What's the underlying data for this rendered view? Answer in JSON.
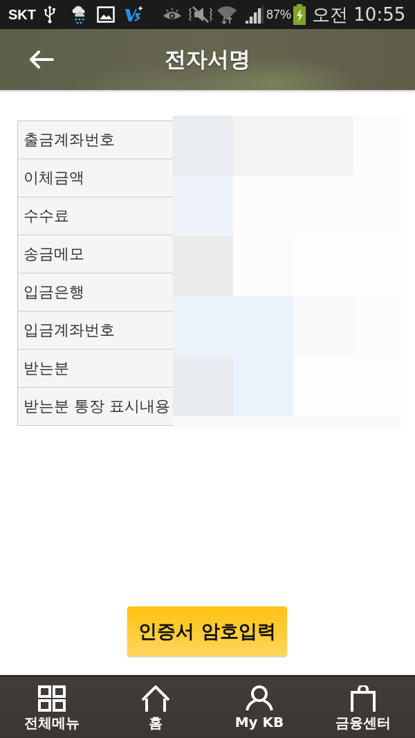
{
  "status_bar": {
    "carrier": "SKT",
    "battery": "87%",
    "time": "오전 10:55"
  },
  "header": {
    "title": "전자서명"
  },
  "details": {
    "rows": [
      {
        "label": "출금계좌번호"
      },
      {
        "label": "이체금액"
      },
      {
        "label": "수수료"
      },
      {
        "label": "송금메모"
      },
      {
        "label": "입금은행"
      },
      {
        "label": "입금계좌번호"
      },
      {
        "label": "받는분"
      },
      {
        "label": "받는분 통장 표시내용"
      }
    ]
  },
  "primary_button": {
    "label": "인증서 암호입력"
  },
  "bottom_nav": {
    "items": [
      {
        "label": "전체메뉴",
        "kind": "grid"
      },
      {
        "label": "홈",
        "kind": "home"
      },
      {
        "label": "My KB",
        "kind": "person"
      },
      {
        "label": "금융센터",
        "kind": "bag"
      }
    ]
  }
}
